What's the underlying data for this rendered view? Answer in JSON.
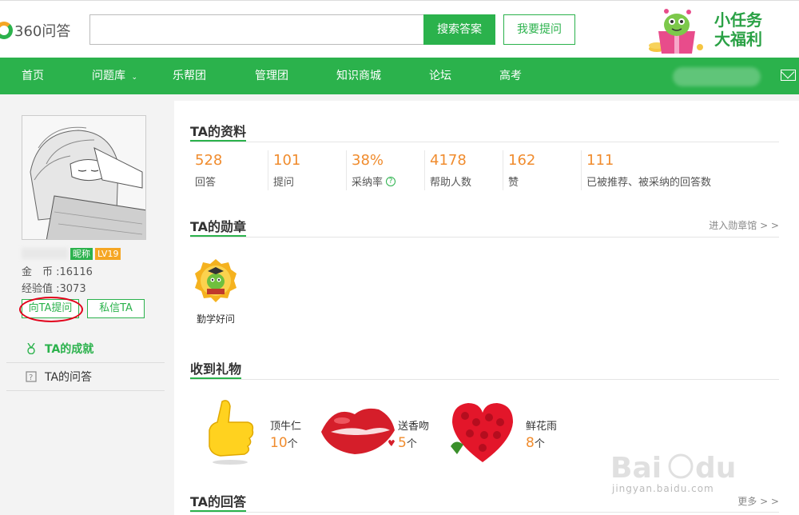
{
  "header": {
    "logo_text": "360问答",
    "search_value": "",
    "search_button": "搜索答案",
    "ask_button": "我要提问",
    "promo_line1": "小任务",
    "promo_line2": "大福利"
  },
  "nav": {
    "items": [
      {
        "label": "首页"
      },
      {
        "label": "问题库"
      },
      {
        "label": "乐帮团"
      },
      {
        "label": "管理团"
      },
      {
        "label": "知识商城"
      },
      {
        "label": "论坛"
      },
      {
        "label": "高考"
      }
    ]
  },
  "profile": {
    "nick_badge": "昵称",
    "level_badge": "LV19",
    "coins_label": "金　币 :",
    "coins_value": "16116",
    "exp_label": "经验值 :",
    "exp_value": "3073",
    "ask_ta_button": "向TA提问",
    "msg_ta_button": "私信TA",
    "menu": [
      {
        "label": "TA的成就"
      },
      {
        "label": "TA的问答"
      }
    ]
  },
  "sections": {
    "info_title": "TA的资料",
    "medals_title": "TA的勋章",
    "medals_more": "进入勋章馆 > >",
    "gifts_title": "收到礼物",
    "answers_title": "TA的回答",
    "answers_more": "更多 > >"
  },
  "stats": [
    {
      "value": "528",
      "label": "回答"
    },
    {
      "value": "101",
      "label": "提问"
    },
    {
      "value": "38%",
      "label": "采纳率"
    },
    {
      "value": "4178",
      "label": "帮助人数"
    },
    {
      "value": "162",
      "label": "赞"
    },
    {
      "value": "111",
      "label": "已被推荐、被采纳的回答数"
    }
  ],
  "medals": [
    {
      "label": "勤学好问"
    }
  ],
  "gifts": [
    {
      "name": "顶牛仁",
      "count": "10",
      "unit": "个"
    },
    {
      "name": "送香吻",
      "count": "5",
      "unit": "个"
    },
    {
      "name": "鲜花雨",
      "count": "8",
      "unit": "个"
    }
  ],
  "watermark": {
    "sub_text": "jingyan.baidu.com"
  },
  "colors": {
    "brand_green": "#2bb24c",
    "accent_orange": "#f08c2e",
    "annotation_red": "#e2001a"
  }
}
